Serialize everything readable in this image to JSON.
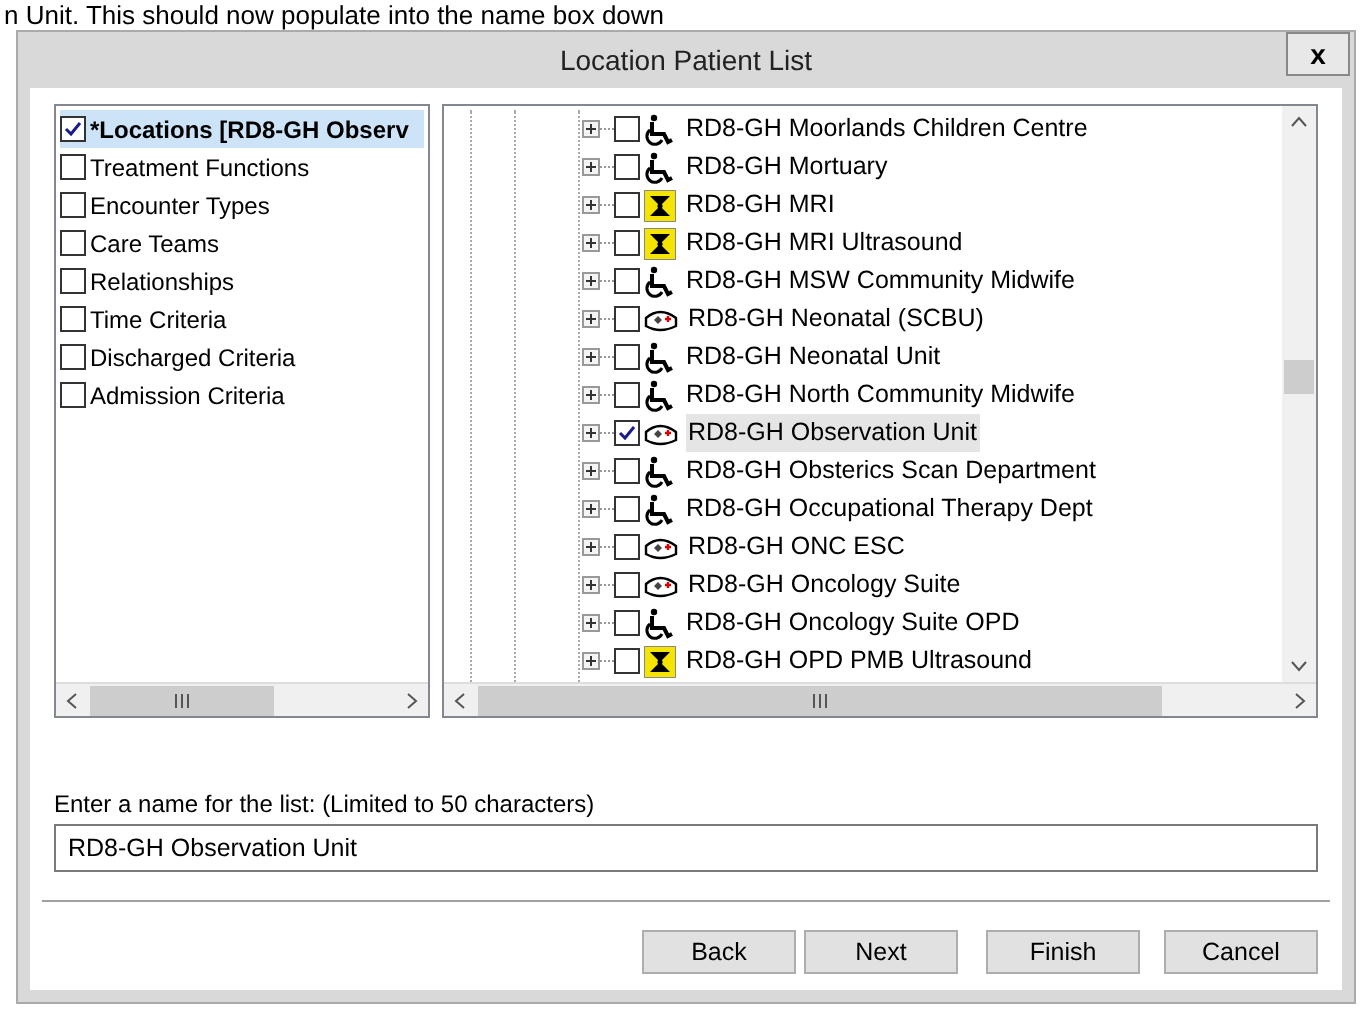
{
  "document_text": "n Unit. This should now populate into the name box down",
  "window": {
    "title": "Location Patient List",
    "close": "x"
  },
  "criteria": [
    {
      "label": "*Locations [RD8-GH Observ",
      "checked": true,
      "selected": true
    },
    {
      "label": "Treatment Functions",
      "checked": false,
      "selected": false
    },
    {
      "label": "Encounter Types",
      "checked": false,
      "selected": false
    },
    {
      "label": "Care Teams",
      "checked": false,
      "selected": false
    },
    {
      "label": "Relationships",
      "checked": false,
      "selected": false
    },
    {
      "label": "Time Criteria",
      "checked": false,
      "selected": false
    },
    {
      "label": "Discharged Criteria",
      "checked": false,
      "selected": false
    },
    {
      "label": "Admission Criteria",
      "checked": false,
      "selected": false
    }
  ],
  "locations": [
    {
      "label": "RD8-GH Moorlands Children Centre",
      "kind": "wheelchair",
      "checked": false,
      "selected": false
    },
    {
      "label": "RD8-GH Mortuary",
      "kind": "wheelchair",
      "checked": false,
      "selected": false
    },
    {
      "label": "RD8-GH MRI",
      "kind": "radiation",
      "checked": false,
      "selected": false
    },
    {
      "label": "RD8-GH MRI Ultrasound",
      "kind": "radiation",
      "checked": false,
      "selected": false
    },
    {
      "label": "RD8-GH MSW Community Midwife",
      "kind": "wheelchair",
      "checked": false,
      "selected": false
    },
    {
      "label": "RD8-GH Neonatal (SCBU)",
      "kind": "bed",
      "checked": false,
      "selected": false
    },
    {
      "label": "RD8-GH Neonatal Unit",
      "kind": "wheelchair",
      "checked": false,
      "selected": false
    },
    {
      "label": "RD8-GH North Community Midwife",
      "kind": "wheelchair",
      "checked": false,
      "selected": false
    },
    {
      "label": "RD8-GH Observation Unit",
      "kind": "bed",
      "checked": true,
      "selected": true
    },
    {
      "label": "RD8-GH Obsterics Scan Department",
      "kind": "wheelchair",
      "checked": false,
      "selected": false
    },
    {
      "label": "RD8-GH Occupational Therapy Dept",
      "kind": "wheelchair",
      "checked": false,
      "selected": false
    },
    {
      "label": "RD8-GH ONC ESC",
      "kind": "bed",
      "checked": false,
      "selected": false
    },
    {
      "label": "RD8-GH Oncology Suite",
      "kind": "bed",
      "checked": false,
      "selected": false
    },
    {
      "label": "RD8-GH Oncology Suite OPD",
      "kind": "wheelchair",
      "checked": false,
      "selected": false
    },
    {
      "label": "RD8-GH OPD PMB Ultrasound",
      "kind": "radiation",
      "checked": false,
      "selected": false
    }
  ],
  "name_field": {
    "label": "Enter a name for the list: (Limited to 50 characters)",
    "value": "RD8-GH Observation Unit"
  },
  "buttons": [
    "Back",
    "Next",
    "Finish",
    "Cancel"
  ]
}
